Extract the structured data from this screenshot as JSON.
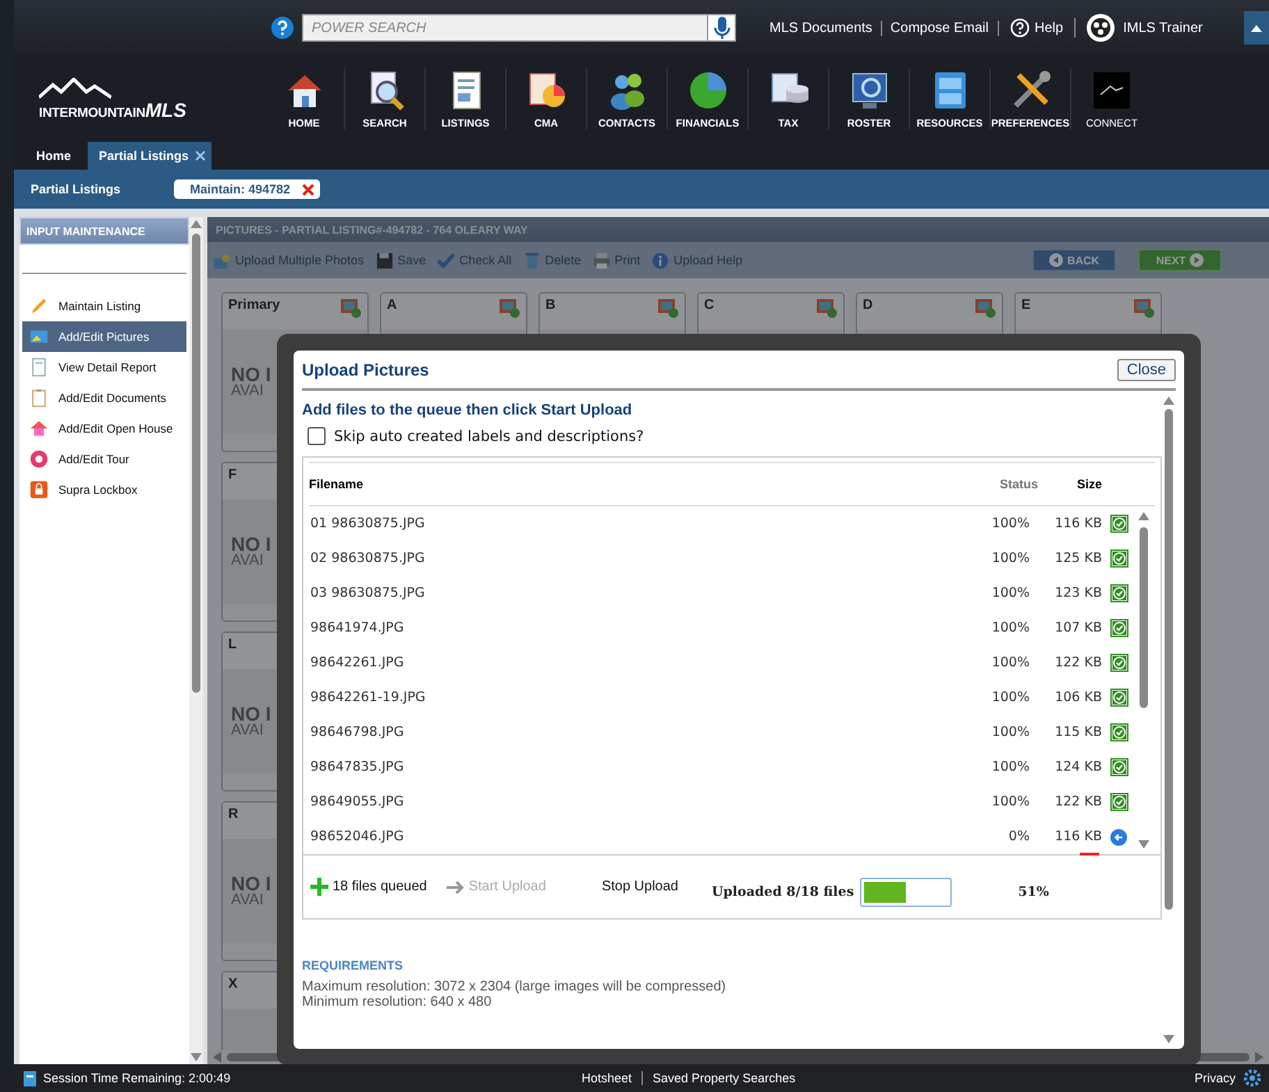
{
  "header": {
    "search": {
      "placeholder": "POWER SEARCH"
    },
    "links": [
      "MLS Documents",
      "Compose Email",
      "Help"
    ],
    "user": "IMLS Trainer",
    "logo": {
      "name": "INTERMOUNTAIN",
      "suffix": "MLS"
    },
    "nav": [
      "HOME",
      "SEARCH",
      "LISTINGS",
      "CMA",
      "CONTACTS",
      "FINANCIALS",
      "TAX",
      "ROSTER",
      "RESOURCES",
      "PREFERENCES",
      "CONNECT"
    ]
  },
  "tabs": [
    {
      "label": "Home",
      "selected": false,
      "closable": false
    },
    {
      "label": "Partial Listings",
      "selected": true,
      "closable": true
    }
  ],
  "subbar": {
    "title": "Partial Listings",
    "chip": "Maintain: 494782"
  },
  "sidebar": {
    "title": "INPUT MAINTENANCE",
    "items": [
      {
        "label": "Maintain Listing",
        "selected": false
      },
      {
        "label": "Add/Edit Pictures",
        "selected": true
      },
      {
        "label": "View Detail Report",
        "selected": false
      },
      {
        "label": "Add/Edit Documents",
        "selected": false
      },
      {
        "label": "Add/Edit Open House",
        "selected": false
      },
      {
        "label": "Add/Edit Tour",
        "selected": false
      },
      {
        "label": "Supra Lockbox",
        "selected": false
      }
    ]
  },
  "panel": {
    "title": "PICTURES - PARTIAL LISTING#-494782 - 764 OLEARY WAY",
    "toolbar": [
      "Upload Multiple Photos",
      "Save",
      "Check All",
      "Delete",
      "Print",
      "Upload Help"
    ],
    "back": "BACK",
    "next": "NEXT",
    "top_tiles": [
      {
        "label": "Primary",
        "stamp_1": "NO I",
        "stamp_2": "AVAI"
      },
      {
        "label": "A"
      },
      {
        "label": "B"
      },
      {
        "label": "C"
      },
      {
        "label": "D"
      },
      {
        "label": "E"
      }
    ],
    "side_tiles": [
      {
        "label": "F",
        "stamp_1": "NO I",
        "stamp_2": "AVAI"
      },
      {
        "label": "L",
        "stamp_1": "NO I",
        "stamp_2": "AVAI"
      },
      {
        "label": "R",
        "stamp_1": "NO I",
        "stamp_2": "AVAI"
      },
      {
        "label": "X"
      }
    ]
  },
  "dialog": {
    "title": "Upload Pictures",
    "close": "Close",
    "heading": "Add files to the queue then click Start Upload",
    "skip": {
      "label": "Skip auto created labels and descriptions?",
      "checked": false
    },
    "columns": [
      "Filename",
      "Status",
      "Size"
    ],
    "files": [
      {
        "name": "01 98630875.JPG",
        "status": "100%",
        "size": "116 KB",
        "complete": true
      },
      {
        "name": "02 98630875.JPG",
        "status": "100%",
        "size": "125 KB",
        "complete": true
      },
      {
        "name": "03 98630875.JPG",
        "status": "100%",
        "size": "123 KB",
        "complete": true
      },
      {
        "name": "98641974.JPG",
        "status": "100%",
        "size": "107 KB",
        "complete": true
      },
      {
        "name": "98642261.JPG",
        "status": "100%",
        "size": "122 KB",
        "complete": true
      },
      {
        "name": "98642261-19.JPG",
        "status": "100%",
        "size": "106 KB",
        "complete": true
      },
      {
        "name": "98646798.JPG",
        "status": "100%",
        "size": "115 KB",
        "complete": true
      },
      {
        "name": "98647835.JPG",
        "status": "100%",
        "size": "124 KB",
        "complete": true
      },
      {
        "name": "98649055.JPG",
        "status": "100%",
        "size": "122 KB",
        "complete": true
      },
      {
        "name": "98652046.JPG",
        "status": "0%",
        "size": "116 KB",
        "complete": false
      }
    ],
    "queued": "18 files queued",
    "start": {
      "label": "Start Upload",
      "disabled": true
    },
    "stop": "Stop Upload",
    "uploaded": "Uploaded 8/18 files",
    "progress": {
      "level": 0.51
    },
    "percent": "51%",
    "requirements": "REQUIREMENTS",
    "lines": [
      "Maximum resolution: 3072 x 2304 (large images will be compressed)",
      "Minimum resolution: 640 x 480"
    ]
  },
  "footer": {
    "session": "Session Time Remaining: 2:00:49",
    "links": [
      "Hotsheet",
      "Saved Property Searches"
    ],
    "privacy": "Privacy"
  }
}
